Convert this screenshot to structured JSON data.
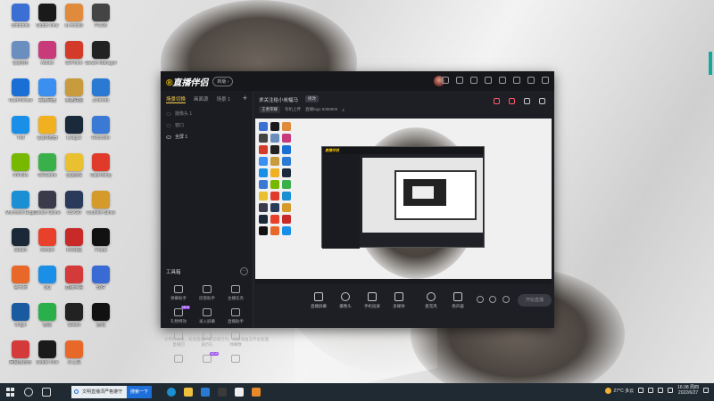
{
  "desktop": {
    "icons": [
      {
        "label": "Bbbbbbb",
        "color": "#3b6fd4"
      },
      {
        "label": "Studio One",
        "color": "#1a1a1a"
      },
      {
        "label": "lu-mobile",
        "color": "#e08a3c"
      },
      {
        "label": "PCDS",
        "color": "#444444"
      },
      {
        "label": "QQ音乐",
        "color": "#6a8fbf"
      },
      {
        "label": "Adobe",
        "color": "#c83a7a"
      },
      {
        "label": "GeForce",
        "color": "#d43a2a"
      },
      {
        "label": "Steam Manager",
        "color": "#222222"
      },
      {
        "label": "TeamViewer",
        "color": "#1a6fd4"
      },
      {
        "label": "百度网盘",
        "color": "#3a8ff0"
      },
      {
        "label": "英雄联盟",
        "color": "#c89b3c"
      },
      {
        "label": "uTorrent",
        "color": "#2a7ad4"
      },
      {
        "label": "TIM",
        "color": "#1a8fe8"
      },
      {
        "label": "QQ浏览器",
        "color": "#f0b020"
      },
      {
        "label": "League",
        "color": "#1a2a3a"
      },
      {
        "label": "Recorder",
        "color": "#3a7ad4"
      },
      {
        "label": "NVIDIA",
        "color": "#76b900"
      },
      {
        "label": "WeGame",
        "color": "#3ab04a"
      },
      {
        "label": "QQ游戏",
        "color": "#e8c030"
      },
      {
        "label": "Clipchamp",
        "color": "#e03a2a"
      },
      {
        "label": "Microsoft Edge",
        "color": "#1a8fd4"
      },
      {
        "label": "Steam Game",
        "color": "#3a3a4a"
      },
      {
        "label": "CS:GO",
        "color": "#2a3a5a"
      },
      {
        "label": "Counter-Strike",
        "color": "#d49a2a"
      },
      {
        "label": "Steam",
        "color": "#1b2838"
      },
      {
        "label": "Xender",
        "color": "#e8402a"
      },
      {
        "label": "KK对战",
        "color": "#c82a2a"
      },
      {
        "label": "Fraud",
        "color": "#111111"
      },
      {
        "label": "鲁大师",
        "color": "#e8682a"
      },
      {
        "label": "QQ",
        "color": "#1a8fe8"
      },
      {
        "label": "直播伴侣",
        "color": "#d43a3a"
      },
      {
        "label": "软件",
        "color": "#3a6ad4"
      },
      {
        "label": "Origin",
        "color": "#1a5aa0"
      },
      {
        "label": "微信",
        "color": "#2ab04a"
      },
      {
        "label": "Steam",
        "color": "#222222"
      },
      {
        "label": "游戏",
        "color": "#111111"
      },
      {
        "label": "网易云音乐",
        "color": "#d43a3a"
      },
      {
        "label": "Studio One",
        "color": "#1a1a1a"
      },
      {
        "label": "小工具",
        "color": "#e8682a"
      }
    ]
  },
  "app": {
    "logo_text": "直播伴侣",
    "logo_mark": "®",
    "version_badge": "新版 ›",
    "left_tabs": [
      {
        "label": "场景切换",
        "active": true
      },
      {
        "label": "画面源",
        "active": false
      },
      {
        "label": "场景 1",
        "active": false
      }
    ],
    "add_symbol": "+",
    "scenes": [
      {
        "label": "摄像头 1",
        "selected": false
      },
      {
        "label": "窗口",
        "selected": false
      },
      {
        "label": "全屏 1",
        "selected": true
      }
    ],
    "tools_heading": "工具箱",
    "tools_more": "···",
    "tools": [
      {
        "label": "弹幕助手",
        "tag": ""
      },
      {
        "label": "房管助手",
        "tag": ""
      },
      {
        "label": "主播任务",
        "tag": ""
      },
      {
        "label": "礼物特效",
        "tag": "NEW"
      },
      {
        "label": "录入屏幕",
        "tag": ""
      },
      {
        "label": "直播助手",
        "tag": ""
      },
      {
        "label": "直播回",
        "tag": ""
      },
      {
        "label": "送历礼",
        "tag": ""
      },
      {
        "label": "弹幕数",
        "tag": ""
      },
      {
        "label": "",
        "tag": ""
      },
      {
        "label": "",
        "tag": "NEW"
      },
      {
        "label": "",
        "tag": ""
      }
    ],
    "notice": "文明的主播，知道直播严禁违规行为，违反须由当平台处理",
    "room_title": "求关注给小炭幅马",
    "room_badge": "修改",
    "room_meta": [
      {
        "text": "王者荣耀",
        "pill": true
      },
      {
        "text": "有机上传",
        "pill": false
      },
      {
        "text": "直播logo 8358500",
        "pill": false
      },
      {
        "text": "4",
        "pill": false
      }
    ],
    "preview_nested_logo": "直播伴侣",
    "controls": [
      {
        "label": "直播屏幕"
      },
      {
        "label": "摄像头"
      },
      {
        "label": "手机投屏"
      },
      {
        "label": "多媒体"
      },
      {
        "label": "麦克风"
      },
      {
        "label": "扬声器"
      }
    ],
    "start_button": "开始直播"
  },
  "taskbar": {
    "search_text": "文明直播须严格遵守",
    "search_button": "搜索一下",
    "weather": "27°C 多云",
    "time": "16:38 周四",
    "date": "2022/6/27"
  },
  "colors": {
    "accent_yellow": "#ffd24a",
    "accent_red": "#ff5a6a",
    "app_bg": "#1e1f24",
    "taskbar_bg": "#1f2a33"
  }
}
